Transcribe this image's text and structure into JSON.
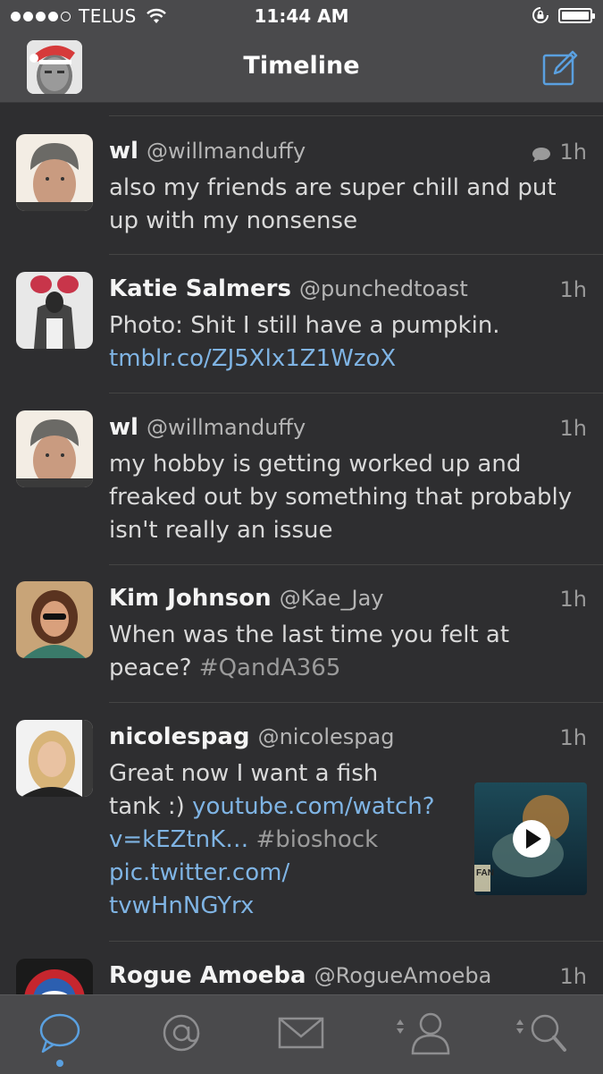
{
  "status_bar": {
    "carrier": "TELUS",
    "time": "11:44 AM",
    "signal_bars": 4,
    "signal_max": 5,
    "icons": [
      "wifi-icon",
      "rotation-lock-icon",
      "battery-icon"
    ]
  },
  "nav": {
    "title": "Timeline",
    "compose_icon": "compose-icon"
  },
  "colors": {
    "accent": "#5aa0e0",
    "link": "#7fb4e4",
    "background": "#2e2e30",
    "bars": "#4a4a4c"
  },
  "tweets": [
    {
      "name": "wl",
      "handle": "@willmanduffy",
      "time": "1h",
      "has_conversation": true,
      "text": "also my friends are super chill and put up with my nonsense"
    },
    {
      "name": "Katie Salmers",
      "handle": "@punchedtoast",
      "time": "1h",
      "text": "Photo: Shit I still have a pumpkin.",
      "link": "tmblr.co/ZJ5Xlx1Z1WzoX"
    },
    {
      "name": "wl",
      "handle": "@willmanduffy",
      "time": "1h",
      "text": "my hobby is getting worked up and freaked out by something that probably isn't really an issue"
    },
    {
      "name": "Kim Johnson",
      "handle": "@Kae_Jay",
      "time": "1h",
      "text": "When was the last time you felt at peace?",
      "hashtag": "#QandA365"
    },
    {
      "name": "nicolespag",
      "handle": "@nicolespag",
      "time": "1h",
      "text_line1": "Great now I want a fish",
      "text_line2": "tank :)",
      "link1a": "youtube.com/watch?",
      "link1b": "v=kEZtnK…",
      "hashtag": "#bioshock",
      "link2a": "pic.twitter.com/",
      "link2b": "tvwHnNGYrx",
      "thumbnail_label": "FAN"
    },
    {
      "name": "Rogue Amoeba",
      "handle": "@RogueAmoeba",
      "time": "1h"
    }
  ],
  "tabs": [
    {
      "name": "timeline",
      "icon": "speech-bubble-icon",
      "active": true
    },
    {
      "name": "mentions",
      "icon": "at-sign-icon",
      "active": false
    },
    {
      "name": "messages",
      "icon": "envelope-icon",
      "active": false
    },
    {
      "name": "profile",
      "icon": "person-icon",
      "active": false
    },
    {
      "name": "search",
      "icon": "magnifier-icon",
      "active": false
    }
  ]
}
